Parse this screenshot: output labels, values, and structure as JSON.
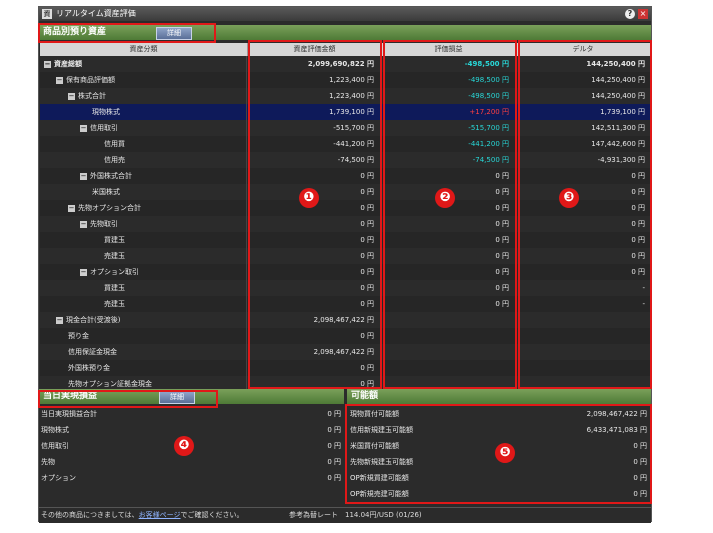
{
  "window": {
    "title": "リアルタイム資産評価",
    "help": "?",
    "close": "×",
    "app_icon": "資"
  },
  "product_section": {
    "title": "商品別預り資産",
    "detail_button": "詳細"
  },
  "columns": [
    "資産分類",
    "資産評価金額",
    "評価損益",
    "デルタ"
  ],
  "rows": [
    {
      "name": "資産総額",
      "v1": "2,099,690,822 円",
      "v2": "-498,500 円",
      "v3": "144,250,400 円"
    },
    {
      "name": "保有商品評価額",
      "v1": "1,223,400 円",
      "v2": "-498,500 円",
      "v3": "144,250,400 円"
    },
    {
      "name": "株式合計",
      "v1": "1,223,400 円",
      "v2": "-498,500 円",
      "v3": "144,250,400 円"
    },
    {
      "name": "現物株式",
      "v1": "1,739,100 円",
      "v2": "+17,200 円",
      "v3": "1,739,100 円"
    },
    {
      "name": "信用取引",
      "v1": "-515,700 円",
      "v2": "-515,700 円",
      "v3": "142,511,300 円"
    },
    {
      "name": "信用買",
      "v1": "-441,200 円",
      "v2": "-441,200 円",
      "v3": "147,442,600 円"
    },
    {
      "name": "信用売",
      "v1": "-74,500 円",
      "v2": "-74,500 円",
      "v3": "-4,931,300 円"
    },
    {
      "name": "外国株式合計",
      "v1": "0 円",
      "v2": "0 円",
      "v3": "0 円"
    },
    {
      "name": "米国株式",
      "v1": "0 円",
      "v2": "0 円",
      "v3": "0 円"
    },
    {
      "name": "先物オプション合計",
      "v1": "0 円",
      "v2": "0 円",
      "v3": "0 円"
    },
    {
      "name": "先物取引",
      "v1": "0 円",
      "v2": "0 円",
      "v3": "0 円"
    },
    {
      "name": "買建玉",
      "v1": "0 円",
      "v2": "0 円",
      "v3": "0 円"
    },
    {
      "name": "売建玉",
      "v1": "0 円",
      "v2": "0 円",
      "v3": "0 円"
    },
    {
      "name": "オプション取引",
      "v1": "0 円",
      "v2": "0 円",
      "v3": "0 円"
    },
    {
      "name": "買建玉",
      "v1": "0 円",
      "v2": "0 円",
      "v3": "-"
    },
    {
      "name": "売建玉",
      "v1": "0 円",
      "v2": "0 円",
      "v3": "-"
    },
    {
      "name": "現金合計(受渡後)",
      "v1": "2,098,467,422 円",
      "v2": "",
      "v3": ""
    },
    {
      "name": "預り金",
      "v1": "0 円",
      "v2": "",
      "v3": ""
    },
    {
      "name": "信用保証金現金",
      "v1": "2,098,467,422 円",
      "v2": "",
      "v3": ""
    },
    {
      "name": "外国株預り金",
      "v1": "0 円",
      "v2": "",
      "v3": ""
    },
    {
      "name": "先物オプション証拠金現金",
      "v1": "0 円",
      "v2": "",
      "v3": ""
    }
  ],
  "annotations": [
    "❶",
    "❷",
    "❸",
    "❹",
    "❺"
  ],
  "realized_section": {
    "title": "当日実現損益",
    "detail_button": "詳細",
    "items": [
      {
        "label": "当日実現損益合計",
        "value": "0 円"
      },
      {
        "label": "現物株式",
        "value": "0 円"
      },
      {
        "label": "信用取引",
        "value": "0 円"
      },
      {
        "label": "先物",
        "value": "0 円"
      },
      {
        "label": "オプション",
        "value": "0 円"
      }
    ]
  },
  "capacity_section": {
    "title": "可能額",
    "items": [
      {
        "label": "現物買付可能額",
        "value": "2,098,467,422 円"
      },
      {
        "label": "信用新規建玉可能額",
        "value": "6,433,471,083 円"
      },
      {
        "label": "米国買付可能額",
        "value": "0 円"
      },
      {
        "label": "先物新規建玉可能額",
        "value": "0 円"
      },
      {
        "label": "OP新規買建可能額",
        "value": "0 円"
      },
      {
        "label": "OP新規売建可能額",
        "value": "0 円"
      }
    ]
  },
  "footer": {
    "text_before": "その他の商品につきましては、",
    "link": "お客様ページ",
    "text_after": "でご確認ください。",
    "rate": "参考為替レート　114.04円/USD (01/26)"
  }
}
